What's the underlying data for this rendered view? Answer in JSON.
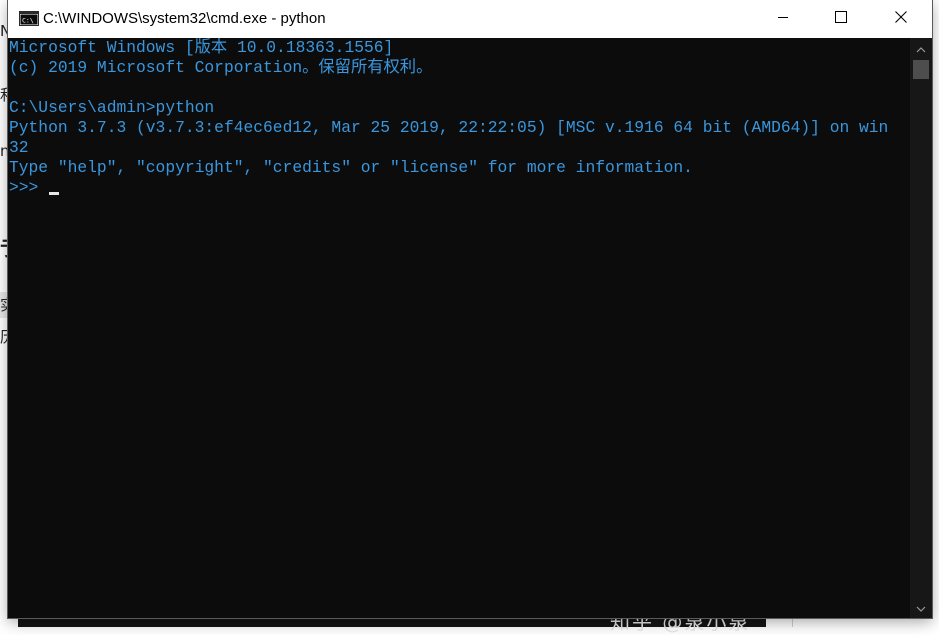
{
  "window": {
    "title": "C:\\WINDOWS\\system32\\cmd.exe - python"
  },
  "console": {
    "lines": [
      "Microsoft Windows [版本 10.0.18363.1556]",
      "(c) 2019 Microsoft Corporation。保留所有权利。",
      "",
      "C:\\Users\\admin>python",
      "Python 3.7.3 (v3.7.3:ef4ec6ed12, Mar 25 2019, 22:22:05) [MSC v.1916 64 bit (AMD64)] on win",
      "32",
      "Type \"help\", \"copyright\", \"credits\" or \"license\" for more information.",
      ">>> "
    ],
    "text_color": "#3a96dd",
    "background_color": "#0c0c0c"
  },
  "background": {
    "watermark": "知乎 @泉小泉",
    "slivers": [
      "N",
      "和",
      "nc",
      "亍",
      "实",
      "历"
    ]
  },
  "icons": {
    "app": "cmd-icon",
    "minimize": "minimize-icon",
    "maximize": "maximize-icon",
    "close": "close-icon",
    "scroll_up": "chevron-up-icon",
    "scroll_down": "chevron-down-icon"
  }
}
